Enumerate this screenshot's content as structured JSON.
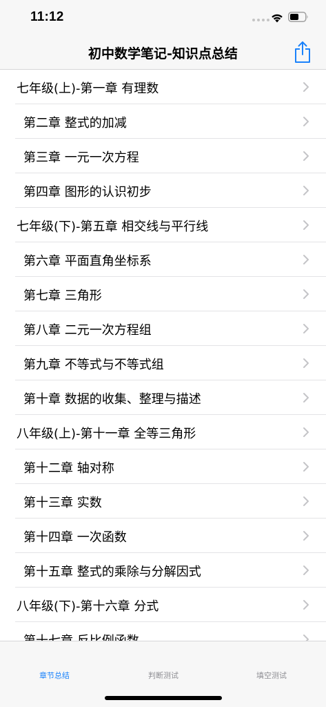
{
  "status_bar": {
    "time": "11:12"
  },
  "nav": {
    "title": "初中数学笔记-知识点总结",
    "share_icon": "share-icon"
  },
  "colors": {
    "accent": "#1a82fb",
    "inactive_tab": "#8e8e93",
    "separator": "#e3e3e6",
    "chevron": "#c4c4c7"
  },
  "list": {
    "rows": [
      {
        "label": "七年级(上)-第一章 有理数",
        "level": 0
      },
      {
        "label": "第二章 整式的加减",
        "level": 1
      },
      {
        "label": "第三章 一元一次方程",
        "level": 1
      },
      {
        "label": "第四章 图形的认识初步",
        "level": 1
      },
      {
        "label": "七年级(下)-第五章 相交线与平行线",
        "level": 0
      },
      {
        "label": "第六章 平面直角坐标系",
        "level": 1
      },
      {
        "label": "第七章 三角形",
        "level": 1
      },
      {
        "label": "第八章 二元一次方程组",
        "level": 1
      },
      {
        "label": "第九章 不等式与不等式组",
        "level": 1
      },
      {
        "label": "第十章 数据的收集、整理与描述",
        "level": 1
      },
      {
        "label": "八年级(上)-第十一章 全等三角形",
        "level": 0
      },
      {
        "label": "第十二章 轴对称",
        "level": 1
      },
      {
        "label": "第十三章 实数",
        "level": 1
      },
      {
        "label": "第十四章 一次函数",
        "level": 1
      },
      {
        "label": "第十五章 整式的乘除与分解因式",
        "level": 1
      },
      {
        "label": "八年级(下)-第十六章 分式",
        "level": 0
      },
      {
        "label": "第十七章 反比例函数",
        "level": 1
      }
    ]
  },
  "tabs": [
    {
      "label": "章节总结",
      "active": true
    },
    {
      "label": "判断测试",
      "active": false
    },
    {
      "label": "填空测试",
      "active": false
    }
  ]
}
